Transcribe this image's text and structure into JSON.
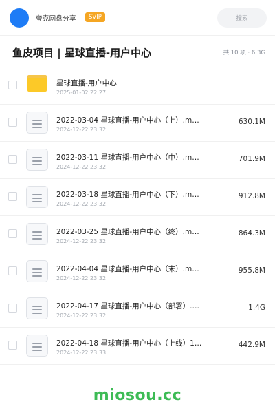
{
  "header": {
    "brand": "夸克网盘分享",
    "badge": "SVIP",
    "search_placeholder": "搜索"
  },
  "folder": {
    "title": "鱼皮项目 | 星球直播-用户中心",
    "summary": "共 10 项 · 6.3G"
  },
  "items": [
    {
      "type": "folder",
      "name": "星球直播-用户中心",
      "date": "2025-01-02 22:27",
      "size": ""
    },
    {
      "type": "file",
      "name": "2022-03-04 星球直播-用户中心（上）.m…",
      "date": "2024-12-22 23:32",
      "size": "630.1M"
    },
    {
      "type": "file",
      "name": "2022-03-11 星球直播-用户中心（中）.m…",
      "date": "2024-12-22 23:32",
      "size": "701.9M"
    },
    {
      "type": "file",
      "name": "2022-03-18 星球直播-用户中心（下）.m…",
      "date": "2024-12-22 23:32",
      "size": "912.8M"
    },
    {
      "type": "file",
      "name": "2022-03-25 星球直播-用户中心（终）.m…",
      "date": "2024-12-22 23:32",
      "size": "864.3M"
    },
    {
      "type": "file",
      "name": "2022-04-04 星球直播-用户中心（末）.m…",
      "date": "2024-12-22 23:32",
      "size": "955.8M"
    },
    {
      "type": "file",
      "name": "2022-04-17 星球直播-用户中心（部署）.…",
      "date": "2024-12-22 23:32",
      "size": "1.4G"
    },
    {
      "type": "file",
      "name": "2022-04-18 星球直播-用户中心（上线）1…",
      "date": "2024-12-22 23:33",
      "size": "442.9M"
    }
  ],
  "watermark": "miosou.cc",
  "colors": {
    "avatar": "#1e7cf6",
    "badge": "#f5a623",
    "folder": "#fcc928",
    "watermark": "#3dbb55"
  }
}
